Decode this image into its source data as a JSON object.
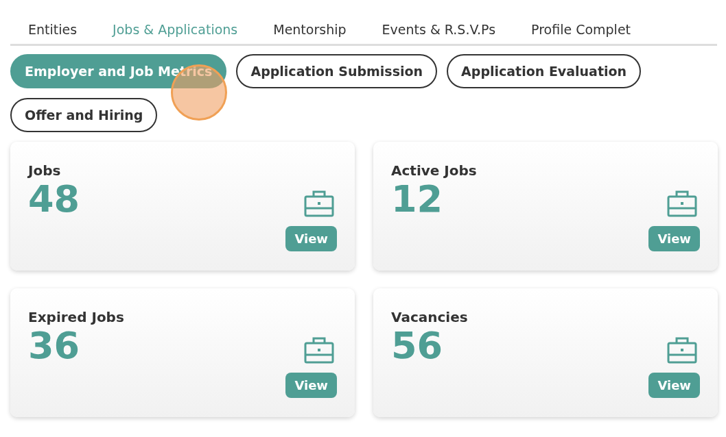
{
  "tabs": [
    {
      "label": "Entities",
      "selected": false
    },
    {
      "label": "Jobs & Applications",
      "selected": true
    },
    {
      "label": "Mentorship",
      "selected": false
    },
    {
      "label": "Events & R.S.V.Ps",
      "selected": false
    },
    {
      "label": "Profile Complet",
      "selected": false
    }
  ],
  "filters": [
    {
      "label": "Employer and Job Metrics",
      "selected": true
    },
    {
      "label": "Application Submission",
      "selected": false
    },
    {
      "label": "Application Evaluation",
      "selected": false
    },
    {
      "label": "Offer and Hiring",
      "selected": false
    }
  ],
  "click_indicator": {
    "on": true
  },
  "cards": [
    {
      "title": "Jobs",
      "value": "48",
      "button": "View"
    },
    {
      "title": "Active Jobs",
      "value": "12",
      "button": "View"
    },
    {
      "title": "Expired Jobs",
      "value": "36",
      "button": "View"
    },
    {
      "title": "Vacancies",
      "value": "56",
      "button": "View"
    }
  ]
}
